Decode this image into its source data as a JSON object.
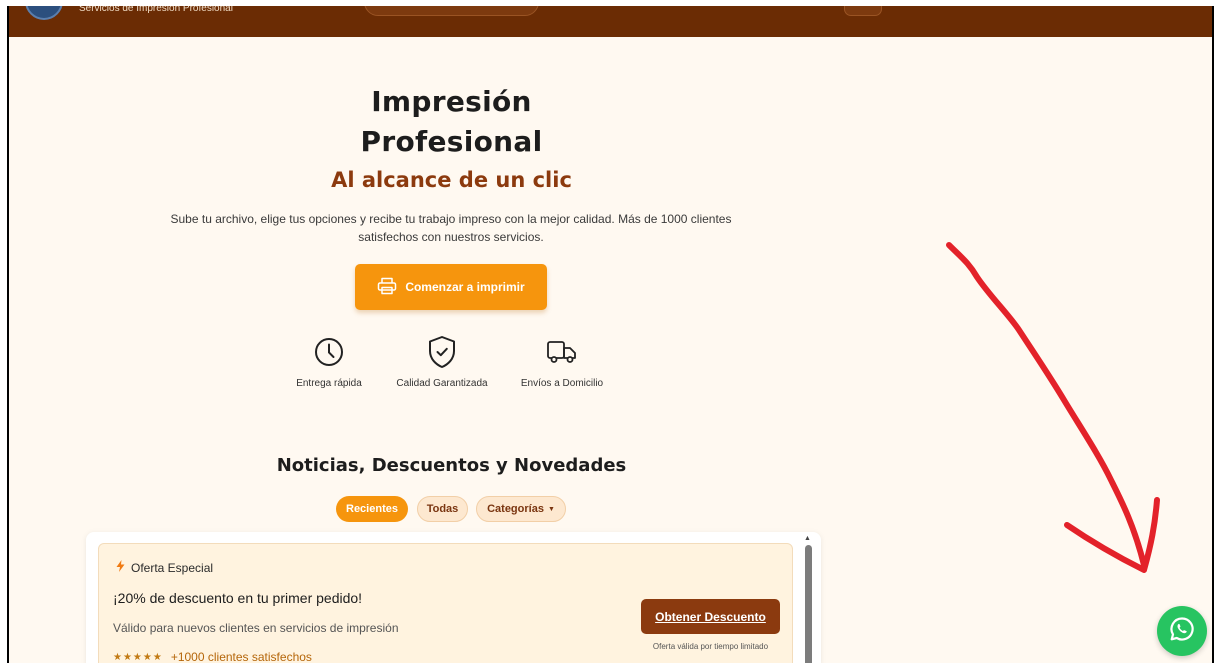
{
  "header": {
    "subtitle": "Servicios de Impresión Profesional"
  },
  "hero": {
    "title_line1": "Impresión",
    "title_line2": "Profesional",
    "subtitle": "Al alcance de un clic",
    "description": "Sube tu archivo, elige tus opciones y recibe tu trabajo impreso con la mejor calidad. Más de 1000 clientes satisfechos con nuestros servicios.",
    "cta_label": "Comenzar a imprimir"
  },
  "features": [
    {
      "icon": "clock-icon",
      "label": "Entrega rápida"
    },
    {
      "icon": "shield-check-icon",
      "label": "Calidad Garantizada"
    },
    {
      "icon": "truck-icon",
      "label": "Envíos a Domicilio"
    }
  ],
  "news": {
    "title": "Noticias, Descuentos y Novedades",
    "tabs": {
      "recent": "Recientes",
      "all": "Todas",
      "categories": "Categorías"
    }
  },
  "offer": {
    "tag": "Oferta Especial",
    "headline": "¡20% de descuento en tu primer pedido!",
    "valid_for": "Válido para nuevos clientes en servicios de impresión",
    "stars": "★★★★★",
    "customers": "+1000 clientes satisfechos",
    "button_label": "Obtener Descuento",
    "note": "Oferta válida por tiempo limitado"
  },
  "colors": {
    "header_bg": "#6b2c04",
    "accent_orange": "#f6950d",
    "brown": "#8b3a0f",
    "whatsapp_green": "#27c461",
    "annotation_red": "#e3222a"
  }
}
